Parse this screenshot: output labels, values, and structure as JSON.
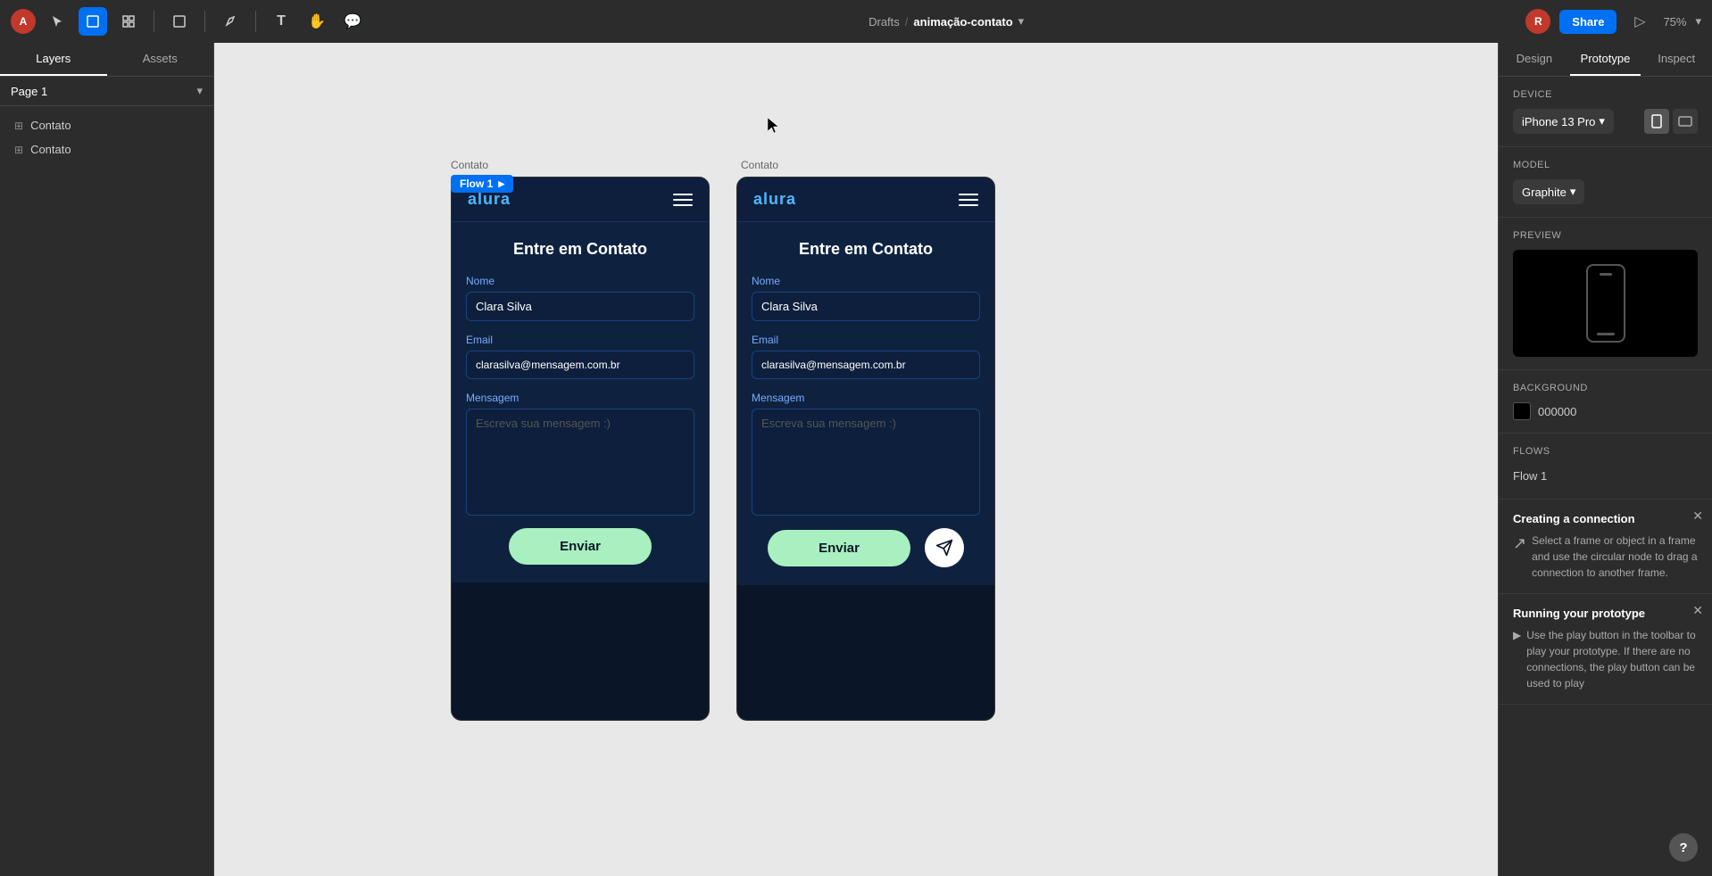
{
  "toolbar": {
    "title": "animação-contato",
    "breadcrumb_separator": "/",
    "breadcrumb_parent": "Drafts",
    "share_label": "Share",
    "zoom_level": "75%",
    "tools": [
      {
        "name": "select",
        "icon": "↖",
        "active": false
      },
      {
        "name": "move",
        "icon": "◻",
        "active": true
      },
      {
        "name": "frame",
        "icon": "⊞",
        "active": false
      },
      {
        "name": "shape",
        "icon": "⬡",
        "active": false
      },
      {
        "name": "text",
        "icon": "T",
        "active": false
      },
      {
        "name": "hand",
        "icon": "✋",
        "active": false
      },
      {
        "name": "comment",
        "icon": "💬",
        "active": false
      }
    ]
  },
  "sidebar": {
    "tabs": [
      {
        "label": "Layers",
        "active": true
      },
      {
        "label": "Assets",
        "active": false
      }
    ],
    "page": "Page 1",
    "layers": [
      {
        "name": "Contato",
        "type": "frame"
      },
      {
        "name": "Contato",
        "type": "frame"
      }
    ]
  },
  "canvas": {
    "frame_labels": [
      "Contato",
      "Contato"
    ],
    "flow_badge": "Flow 1"
  },
  "frames": [
    {
      "id": "frame-1",
      "nav_logo": "alura",
      "title": "Entre em Contato",
      "fields": [
        {
          "label": "Nome",
          "value": "Clara Silva",
          "type": "input"
        },
        {
          "label": "Email",
          "value": "clarasilva@mensagem.com.br",
          "type": "input"
        },
        {
          "label": "Mensagem",
          "value": "",
          "placeholder": "Escreva sua mensagem :)",
          "type": "textarea"
        }
      ],
      "submit_label": "Enviar",
      "has_icon_btn": false
    },
    {
      "id": "frame-2",
      "nav_logo": "alura",
      "title": "Entre em Contato",
      "fields": [
        {
          "label": "Nome",
          "value": "Clara Silva",
          "type": "input"
        },
        {
          "label": "Email",
          "value": "clarasilva@mensagem.com.br",
          "type": "input"
        },
        {
          "label": "Mensagem",
          "value": "",
          "placeholder": "Escreva sua mensagem :)",
          "type": "textarea"
        }
      ],
      "submit_label": "Enviar",
      "has_icon_btn": true
    }
  ],
  "right_panel": {
    "tabs": [
      "Design",
      "Prototype",
      "Inspect"
    ],
    "active_tab": "Prototype",
    "device": {
      "section_title": "Device",
      "name": "iPhone 13 Pro",
      "model_section_title": "Model",
      "model": "Graphite"
    },
    "preview_section_title": "Preview",
    "background": {
      "section_title": "Background",
      "color": "#000000",
      "hex": "000000"
    },
    "flows": {
      "section_title": "Flows",
      "items": [
        "Flow 1"
      ]
    },
    "creating_connection": {
      "title": "Creating a connection",
      "text": "Select a frame or object in a frame and use the circular node to drag a connection to another frame."
    },
    "running_prototype": {
      "title": "Running your prototype",
      "text": "Use the play button in the toolbar to play your prototype. If there are no connections, the play button can be used to play"
    }
  }
}
